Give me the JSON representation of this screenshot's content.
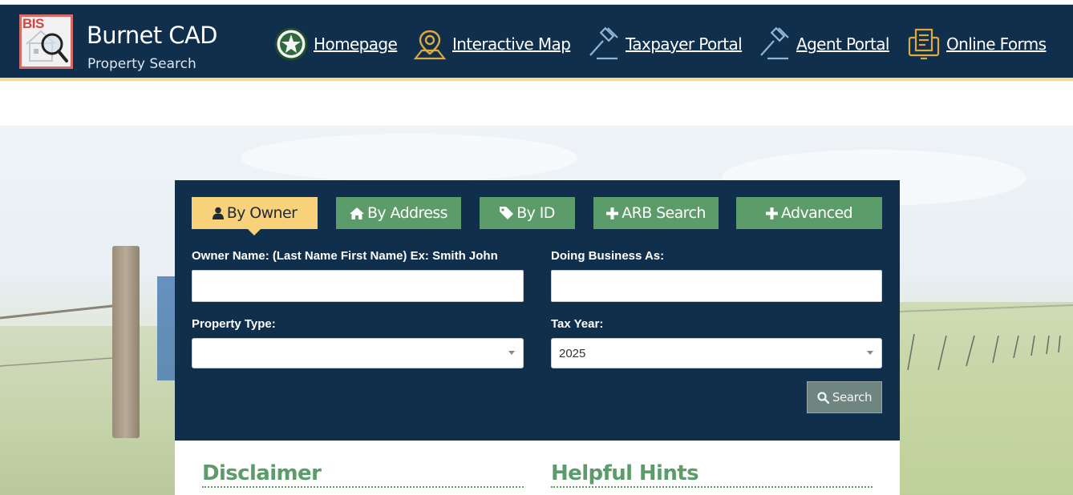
{
  "brand": {
    "logo_text": "BIS",
    "title": "Burnet CAD",
    "subtitle": "Property Search"
  },
  "nav": [
    {
      "label": "Homepage",
      "icon": "texas-star-seal-icon"
    },
    {
      "label": "Interactive Map",
      "icon": "map-pin-icon"
    },
    {
      "label": "Taxpayer Portal",
      "icon": "gavel-icon"
    },
    {
      "label": "Agent Portal",
      "icon": "gavel-icon"
    },
    {
      "label": "Online Forms",
      "icon": "form-monitor-icon"
    }
  ],
  "tabs": [
    {
      "label": "By Owner",
      "icon": "user-icon",
      "active": true
    },
    {
      "label": "By Address",
      "icon": "home-icon",
      "active": false
    },
    {
      "label": "By ID",
      "icon": "tag-icon",
      "active": false
    },
    {
      "label": "ARB Search",
      "icon": "plus-icon",
      "active": false
    },
    {
      "label": "Advanced",
      "icon": "plus-icon",
      "active": false
    }
  ],
  "form": {
    "owner_name_label": "Owner Name: (Last Name First Name) Ex: Smith John",
    "owner_name_value": "",
    "dba_label": "Doing Business As:",
    "dba_value": "",
    "property_type_label": "Property Type:",
    "property_type_value": "",
    "tax_year_label": "Tax Year:",
    "tax_year_value": "2025",
    "search_label": "Search"
  },
  "info": {
    "disclaimer_title": "Disclaimer",
    "hints_title": "Helpful Hints"
  },
  "colors": {
    "header_bg": "#0f2f4c",
    "accent_gold": "#f8d27b",
    "tab_green": "#5c9b6a",
    "search_btn": "#6f8580"
  }
}
